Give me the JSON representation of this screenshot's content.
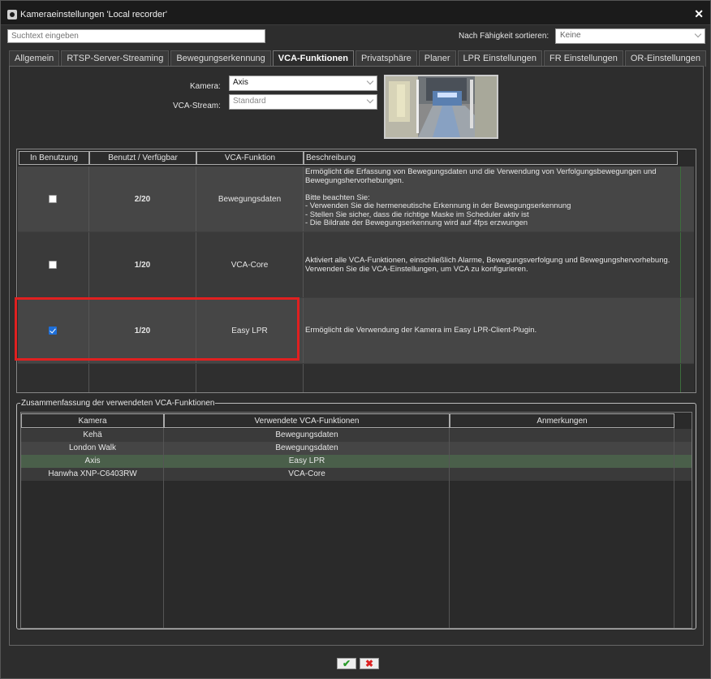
{
  "window": {
    "title": "Kameraeinstellungen 'Local recorder'",
    "close_glyph": "✕"
  },
  "search": {
    "placeholder": "Suchtext eingeben"
  },
  "sort": {
    "label": "Nach Fähigkeit sortieren:",
    "value": "Keine"
  },
  "tabs": [
    {
      "label": "Allgemein"
    },
    {
      "label": "RTSP-Server-Streaming"
    },
    {
      "label": "Bewegungserkennung"
    },
    {
      "label": "VCA-Funktionen",
      "active": true
    },
    {
      "label": "Privatsphäre"
    },
    {
      "label": "Planer"
    },
    {
      "label": "LPR Einstellungen"
    },
    {
      "label": "FR Einstellungen"
    },
    {
      "label": "OR-Einstellungen"
    }
  ],
  "camera": {
    "label": "Kamera:",
    "value": "Axis"
  },
  "stream": {
    "label": "VCA-Stream:",
    "value": "Standard"
  },
  "functions_table": {
    "headers": [
      "In Benutzung",
      "Benutzt / Verfügbar",
      "VCA-Funktion",
      "Beschreibung"
    ],
    "rows": [
      {
        "in_use": false,
        "usage": "2/20",
        "function": "Bewegungsdaten",
        "description": [
          "Ermöglicht die Erfassung von Bewegungsdaten und die Verwendung von Verfolgungsbewegungen und",
          "Bewegungshervorhebungen.",
          "",
          "Bitte beachten Sie:",
          "- Verwenden Sie die hermeneutische Erkennung in der Bewegungserkennung",
          "- Stellen Sie sicher, dass die richtige Maske im Scheduler aktiv ist",
          "- Die Bildrate der Bewegungserkennung wird auf 4fps erzwungen"
        ]
      },
      {
        "in_use": false,
        "usage": "1/20",
        "function": "VCA-Core",
        "description": [
          "Aktiviert alle VCA-Funktionen, einschließlich Alarme, Bewegungsverfolgung und Bewegungshervorhebung.",
          "Verwenden Sie die VCA-Einstellungen, um VCA zu konfigurieren."
        ]
      },
      {
        "in_use": true,
        "usage": "1/20",
        "function": "Easy LPR",
        "description": [
          "Ermöglicht die Verwendung der Kamera im Easy LPR-Client-Plugin."
        ]
      }
    ]
  },
  "summary": {
    "legend": "Zusammenfassung der verwendeten VCA-Funktionen",
    "headers": [
      "Kamera",
      "Verwendete VCA-Funktionen",
      "Anmerkungen"
    ],
    "rows": [
      {
        "camera": "Kehä",
        "functions": "Bewegungsdaten",
        "notes": ""
      },
      {
        "camera": "London Walk",
        "functions": "Bewegungsdaten",
        "notes": ""
      },
      {
        "camera": "Axis",
        "functions": "Easy LPR",
        "notes": "",
        "selected": true
      },
      {
        "camera": "Hanwha XNP-C6403RW",
        "functions": "VCA-Core",
        "notes": ""
      }
    ]
  },
  "buttons": {
    "ok_glyph": "✔",
    "cancel_glyph": "✖"
  },
  "colors": {
    "highlight": "#e02020",
    "selected_row": "#4a5f4a",
    "checkbox_checked": "#1e6fd9"
  }
}
